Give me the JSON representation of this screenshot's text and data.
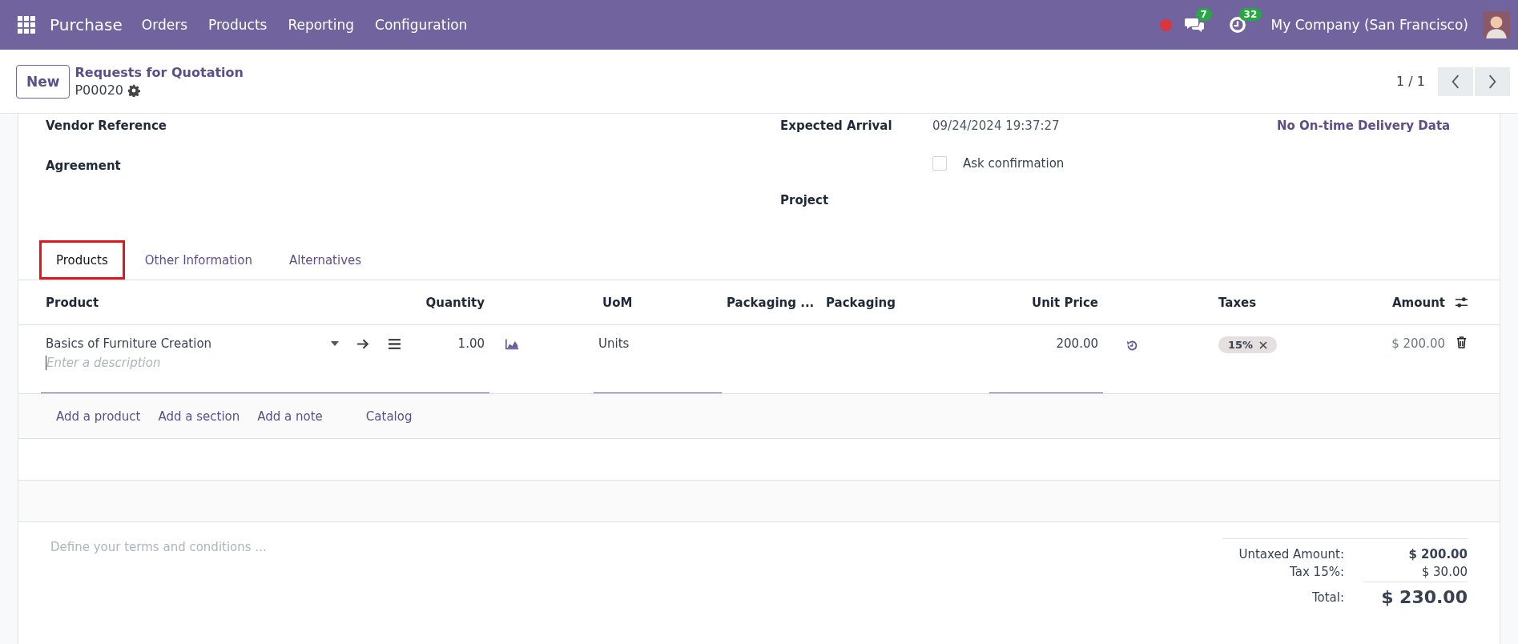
{
  "navbar": {
    "app_name": "Purchase",
    "menu": [
      "Orders",
      "Products",
      "Reporting",
      "Configuration"
    ],
    "messages_badge": "7",
    "activities_badge": "32",
    "company": "My Company (San Francisco)"
  },
  "control_panel": {
    "new_button": "New",
    "breadcrumb": "Requests for Quotation",
    "record": "P00020",
    "pager": "1 / 1"
  },
  "form": {
    "left": [
      {
        "label": "Vendor Reference"
      },
      {
        "label": "Agreement"
      }
    ],
    "right": [
      {
        "kind": "text",
        "label": "Expected Arrival",
        "value": "09/24/2024 19:37:27"
      },
      {
        "kind": "checkbox",
        "label": "Ask confirmation",
        "checked": false
      },
      {
        "kind": "text",
        "label": "Project"
      }
    ],
    "on_time": "No On-time Delivery Data"
  },
  "tabs": [
    {
      "label": "Products",
      "selected": true
    },
    {
      "label": "Other Information",
      "selected": false
    },
    {
      "label": "Alternatives",
      "selected": false
    }
  ],
  "table": {
    "columns": [
      "Product",
      "Quantity",
      "UoM",
      "Packaging ...",
      "Packaging",
      "Unit Price",
      "Taxes",
      "Amount"
    ],
    "rows": [
      {
        "product": "Basics of Furniture Creation",
        "description_placeholder": "Enter a description",
        "quantity": "1.00",
        "uom": "Units",
        "unit_price": "200.00",
        "taxes": [
          "15%"
        ],
        "amount": "$ 200.00"
      }
    ],
    "add_links": [
      "Add a product",
      "Add a section",
      "Add a note",
      "Catalog"
    ]
  },
  "terms_placeholder": "Define your terms and conditions ...",
  "totals": [
    {
      "label": "Untaxed Amount:",
      "value": "$ 200.00",
      "kind": "subtotal"
    },
    {
      "label": "Tax 15%:",
      "value": "$ 30.00",
      "kind": "tax"
    },
    {
      "label": "Total:",
      "value": "$ 230.00",
      "kind": "total"
    }
  ]
}
